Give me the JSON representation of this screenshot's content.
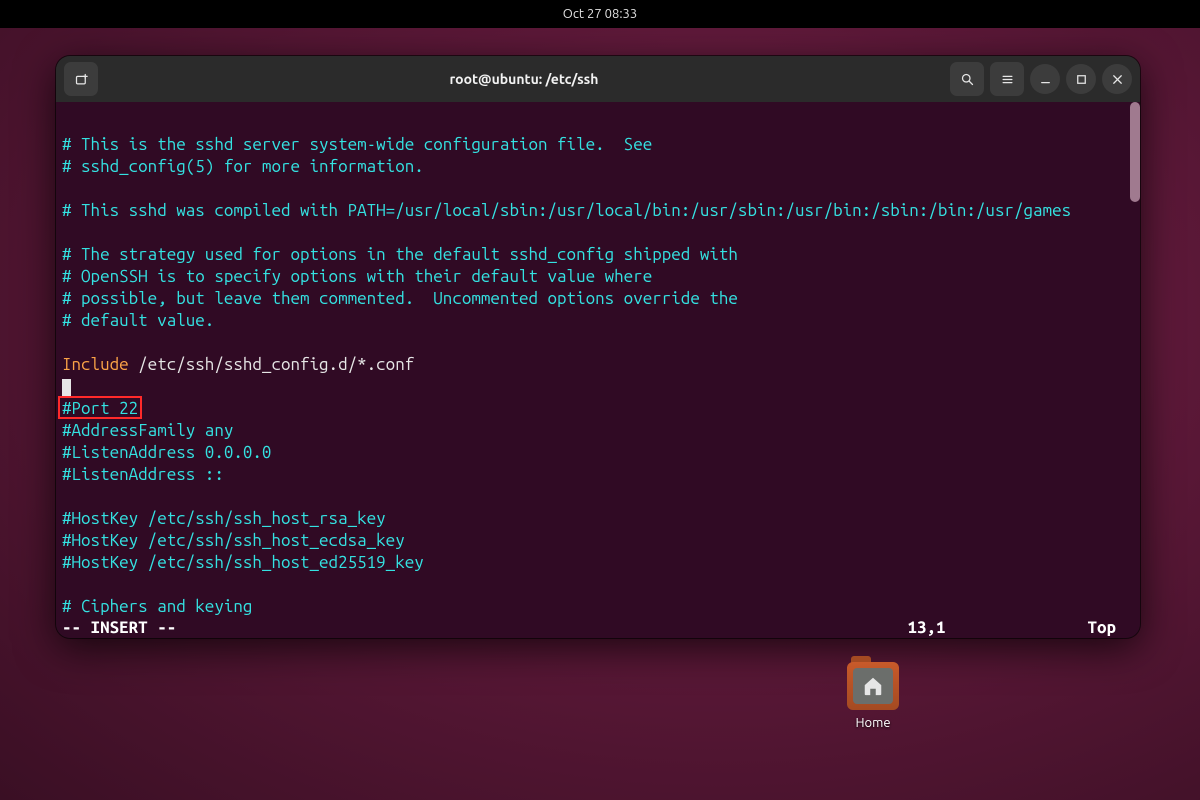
{
  "topbar": {
    "clock": "Oct 27  08:33"
  },
  "window": {
    "title": "root@ubuntu: /etc/ssh",
    "buttons": {
      "new_tab": "new-tab",
      "search": "search",
      "menu": "menu",
      "minimize": "minimize",
      "maximize": "maximize",
      "close": "close"
    }
  },
  "editor": {
    "lines": [
      {
        "text": "",
        "cls": ""
      },
      {
        "text": "# This is the sshd server system-wide configuration file.  See",
        "cls": "c-comment"
      },
      {
        "text": "# sshd_config(5) for more information.",
        "cls": "c-comment"
      },
      {
        "text": "",
        "cls": ""
      },
      {
        "text": "# This sshd was compiled with PATH=/usr/local/sbin:/usr/local/bin:/usr/sbin:/usr/bin:/sbin:/bin:/usr/games",
        "cls": "c-comment"
      },
      {
        "text": "",
        "cls": ""
      },
      {
        "text": "# The strategy used for options in the default sshd_config shipped with",
        "cls": "c-comment"
      },
      {
        "text": "# OpenSSH is to specify options with their default value where",
        "cls": "c-comment"
      },
      {
        "text": "# possible, but leave them commented.  Uncommented options override the",
        "cls": "c-comment"
      },
      {
        "text": "# default value.",
        "cls": "c-comment"
      },
      {
        "text": "",
        "cls": ""
      },
      {
        "keyword": "Include",
        "rest": " /etc/ssh/sshd_config.d/*.conf",
        "cls": "mixed"
      },
      {
        "cursor": true
      },
      {
        "text": "#Port 22",
        "cls": "c-comment",
        "boxed": true
      },
      {
        "text": "#AddressFamily any",
        "cls": "c-comment"
      },
      {
        "text": "#ListenAddress 0.0.0.0",
        "cls": "c-comment"
      },
      {
        "text": "#ListenAddress ::",
        "cls": "c-comment"
      },
      {
        "text": "",
        "cls": ""
      },
      {
        "text": "#HostKey /etc/ssh/ssh_host_rsa_key",
        "cls": "c-comment"
      },
      {
        "text": "#HostKey /etc/ssh/ssh_host_ecdsa_key",
        "cls": "c-comment"
      },
      {
        "text": "#HostKey /etc/ssh/ssh_host_ed25519_key",
        "cls": "c-comment"
      },
      {
        "text": "",
        "cls": ""
      },
      {
        "text": "# Ciphers and keying",
        "cls": "c-comment"
      }
    ],
    "status": {
      "mode": "-- INSERT --",
      "position": "13,1",
      "location": "Top"
    },
    "highlight_text": "#Port 22"
  },
  "desktop": {
    "home_label": "Home"
  }
}
